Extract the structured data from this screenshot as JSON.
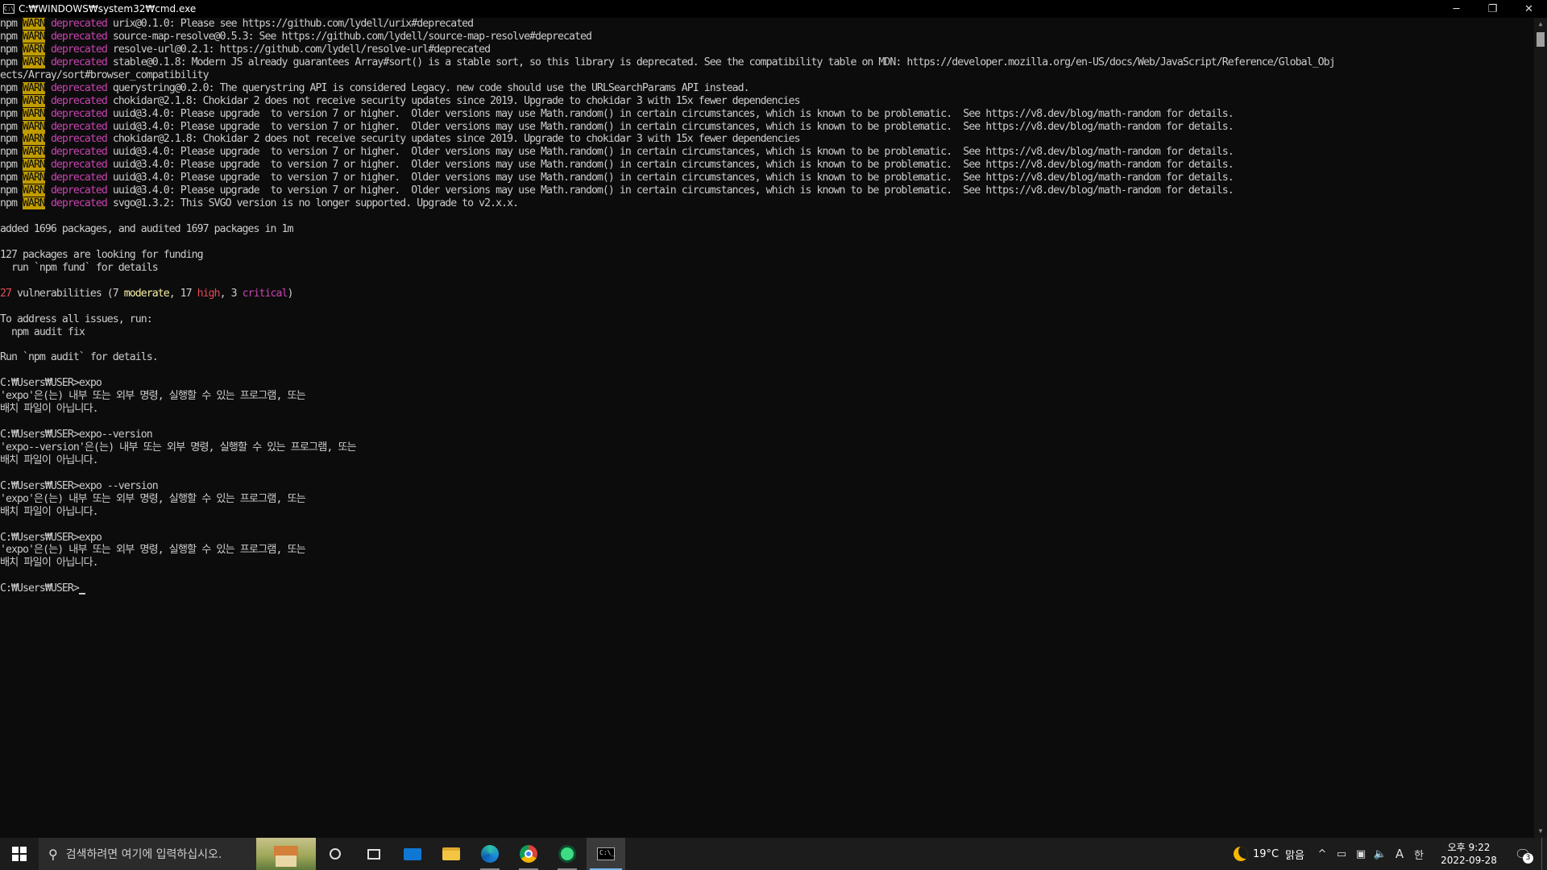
{
  "window": {
    "title": "C:₩WINDOWS₩system32₩cmd.exe",
    "icon": "cmd-window-icon",
    "minimize_label": "─",
    "restore_label": "❐",
    "close_label": "✕"
  },
  "console": {
    "lines": [
      [
        {
          "t": "npm "
        },
        {
          "t": "WARN",
          "c": "warn"
        },
        {
          "t": " "
        },
        {
          "t": "deprecated",
          "c": "dep"
        },
        {
          "t": " urix@0.1.0: Please see https://github.com/lydell/urix#deprecated"
        }
      ],
      [
        {
          "t": "npm "
        },
        {
          "t": "WARN",
          "c": "warn"
        },
        {
          "t": " "
        },
        {
          "t": "deprecated",
          "c": "dep"
        },
        {
          "t": " source-map-resolve@0.5.3: See https://github.com/lydell/source-map-resolve#deprecated"
        }
      ],
      [
        {
          "t": "npm "
        },
        {
          "t": "WARN",
          "c": "warn"
        },
        {
          "t": " "
        },
        {
          "t": "deprecated",
          "c": "dep"
        },
        {
          "t": " resolve-url@0.2.1: https://github.com/lydell/resolve-url#deprecated"
        }
      ],
      [
        {
          "t": "npm "
        },
        {
          "t": "WARN",
          "c": "warn"
        },
        {
          "t": " "
        },
        {
          "t": "deprecated",
          "c": "dep"
        },
        {
          "t": " stable@0.1.8: Modern JS already guarantees Array#sort() is a stable sort, so this library is deprecated. See the compatibility table on MDN: https://developer.mozilla.org/en-US/docs/Web/JavaScript/Reference/Global_Obj"
        }
      ],
      [
        {
          "t": "ects/Array/sort#browser_compatibility"
        }
      ],
      [
        {
          "t": "npm "
        },
        {
          "t": "WARN",
          "c": "warn"
        },
        {
          "t": " "
        },
        {
          "t": "deprecated",
          "c": "dep"
        },
        {
          "t": " querystring@0.2.0: The querystring API is considered Legacy. new code should use the URLSearchParams API instead."
        }
      ],
      [
        {
          "t": "npm "
        },
        {
          "t": "WARN",
          "c": "warn"
        },
        {
          "t": " "
        },
        {
          "t": "deprecated",
          "c": "dep"
        },
        {
          "t": " chokidar@2.1.8: Chokidar 2 does not receive security updates since 2019. Upgrade to chokidar 3 with 15x fewer dependencies"
        }
      ],
      [
        {
          "t": "npm "
        },
        {
          "t": "WARN",
          "c": "warn"
        },
        {
          "t": " "
        },
        {
          "t": "deprecated",
          "c": "dep"
        },
        {
          "t": " uuid@3.4.0: Please upgrade  to version 7 or higher.  Older versions may use Math.random() in certain circumstances, which is known to be problematic.  See https://v8.dev/blog/math-random for details."
        }
      ],
      [
        {
          "t": "npm "
        },
        {
          "t": "WARN",
          "c": "warn"
        },
        {
          "t": " "
        },
        {
          "t": "deprecated",
          "c": "dep"
        },
        {
          "t": " uuid@3.4.0: Please upgrade  to version 7 or higher.  Older versions may use Math.random() in certain circumstances, which is known to be problematic.  See https://v8.dev/blog/math-random for details."
        }
      ],
      [
        {
          "t": "npm "
        },
        {
          "t": "WARN",
          "c": "warn"
        },
        {
          "t": " "
        },
        {
          "t": "deprecated",
          "c": "dep"
        },
        {
          "t": " chokidar@2.1.8: Chokidar 2 does not receive security updates since 2019. Upgrade to chokidar 3 with 15x fewer dependencies"
        }
      ],
      [
        {
          "t": "npm "
        },
        {
          "t": "WARN",
          "c": "warn"
        },
        {
          "t": " "
        },
        {
          "t": "deprecated",
          "c": "dep"
        },
        {
          "t": " uuid@3.4.0: Please upgrade  to version 7 or higher.  Older versions may use Math.random() in certain circumstances, which is known to be problematic.  See https://v8.dev/blog/math-random for details."
        }
      ],
      [
        {
          "t": "npm "
        },
        {
          "t": "WARN",
          "c": "warn"
        },
        {
          "t": " "
        },
        {
          "t": "deprecated",
          "c": "dep"
        },
        {
          "t": " uuid@3.4.0: Please upgrade  to version 7 or higher.  Older versions may use Math.random() in certain circumstances, which is known to be problematic.  See https://v8.dev/blog/math-random for details."
        }
      ],
      [
        {
          "t": "npm "
        },
        {
          "t": "WARN",
          "c": "warn"
        },
        {
          "t": " "
        },
        {
          "t": "deprecated",
          "c": "dep"
        },
        {
          "t": " uuid@3.4.0: Please upgrade  to version 7 or higher.  Older versions may use Math.random() in certain circumstances, which is known to be problematic.  See https://v8.dev/blog/math-random for details."
        }
      ],
      [
        {
          "t": "npm "
        },
        {
          "t": "WARN",
          "c": "warn"
        },
        {
          "t": " "
        },
        {
          "t": "deprecated",
          "c": "dep"
        },
        {
          "t": " uuid@3.4.0: Please upgrade  to version 7 or higher.  Older versions may use Math.random() in certain circumstances, which is known to be problematic.  See https://v8.dev/blog/math-random for details."
        }
      ],
      [
        {
          "t": "npm "
        },
        {
          "t": "WARN",
          "c": "warn"
        },
        {
          "t": " "
        },
        {
          "t": "deprecated",
          "c": "dep"
        },
        {
          "t": " svgo@1.3.2: This SVGO version is no longer supported. Upgrade to v2.x.x."
        }
      ],
      [],
      [
        {
          "t": "added 1696 packages, and audited 1697 packages in 1m"
        }
      ],
      [],
      [
        {
          "t": "127 packages are looking for funding"
        }
      ],
      [
        {
          "t": "  run `npm fund` for details"
        }
      ],
      [],
      [
        {
          "t": "27",
          "c": "red"
        },
        {
          "t": " vulnerabilities (7 "
        },
        {
          "t": "moderate",
          "c": "mod"
        },
        {
          "t": ", 17 "
        },
        {
          "t": "high",
          "c": "red"
        },
        {
          "t": ", 3 "
        },
        {
          "t": "critical",
          "c": "dep"
        },
        {
          "t": ")"
        }
      ],
      [],
      [
        {
          "t": "To address all issues, run:"
        }
      ],
      [
        {
          "t": "  npm audit fix"
        }
      ],
      [],
      [
        {
          "t": "Run `npm audit` for details."
        }
      ],
      [],
      [
        {
          "t": "C:₩Users₩USER>expo"
        }
      ],
      [
        {
          "t": "'expo'은(는) 내부 또는 외부 명령, 실행할 수 있는 프로그램, 또는"
        }
      ],
      [
        {
          "t": "배치 파일이 아닙니다."
        }
      ],
      [],
      [
        {
          "t": "C:₩Users₩USER>expo--version"
        }
      ],
      [
        {
          "t": "'expo--version'은(는) 내부 또는 외부 명령, 실행할 수 있는 프로그램, 또는"
        }
      ],
      [
        {
          "t": "배치 파일이 아닙니다."
        }
      ],
      [],
      [
        {
          "t": "C:₩Users₩USER>expo --version"
        }
      ],
      [
        {
          "t": "'expo'은(는) 내부 또는 외부 명령, 실행할 수 있는 프로그램, 또는"
        }
      ],
      [
        {
          "t": "배치 파일이 아닙니다."
        }
      ],
      [],
      [
        {
          "t": "C:₩Users₩USER>expo"
        }
      ],
      [
        {
          "t": "'expo'은(는) 내부 또는 외부 명령, 실행할 수 있는 프로그램, 또는"
        }
      ],
      [
        {
          "t": "배치 파일이 아닙니다."
        }
      ],
      [],
      [
        {
          "t": "C:₩Users₩USER>"
        },
        {
          "cursor": true
        }
      ]
    ],
    "colors": {
      "background": "#0c0c0c",
      "foreground": "#cccccc",
      "warn_bg": "#c19c00",
      "deprecated": "#c844b0",
      "red": "#e74856",
      "moderate": "#f9f1a5"
    }
  },
  "scrollbar": {
    "up_arrow": "▲",
    "down_arrow": "▼"
  },
  "taskbar": {
    "search_placeholder": "검색하려면 여기에 입력하십시오.",
    "pinned": [
      "cortana-icon",
      "task-view-icon",
      "mail-icon",
      "file-explorer-icon",
      "edge-icon",
      "chrome-icon",
      "android-studio-icon",
      "cmd-icon"
    ],
    "weather_temp": "19°C",
    "weather_desc": "맑음",
    "tray_chevron": "^",
    "ime_mode": "A",
    "ime_lang": "한",
    "clock_time": "오후 9:22",
    "clock_date": "2022-09-28",
    "notification_count": "3"
  }
}
